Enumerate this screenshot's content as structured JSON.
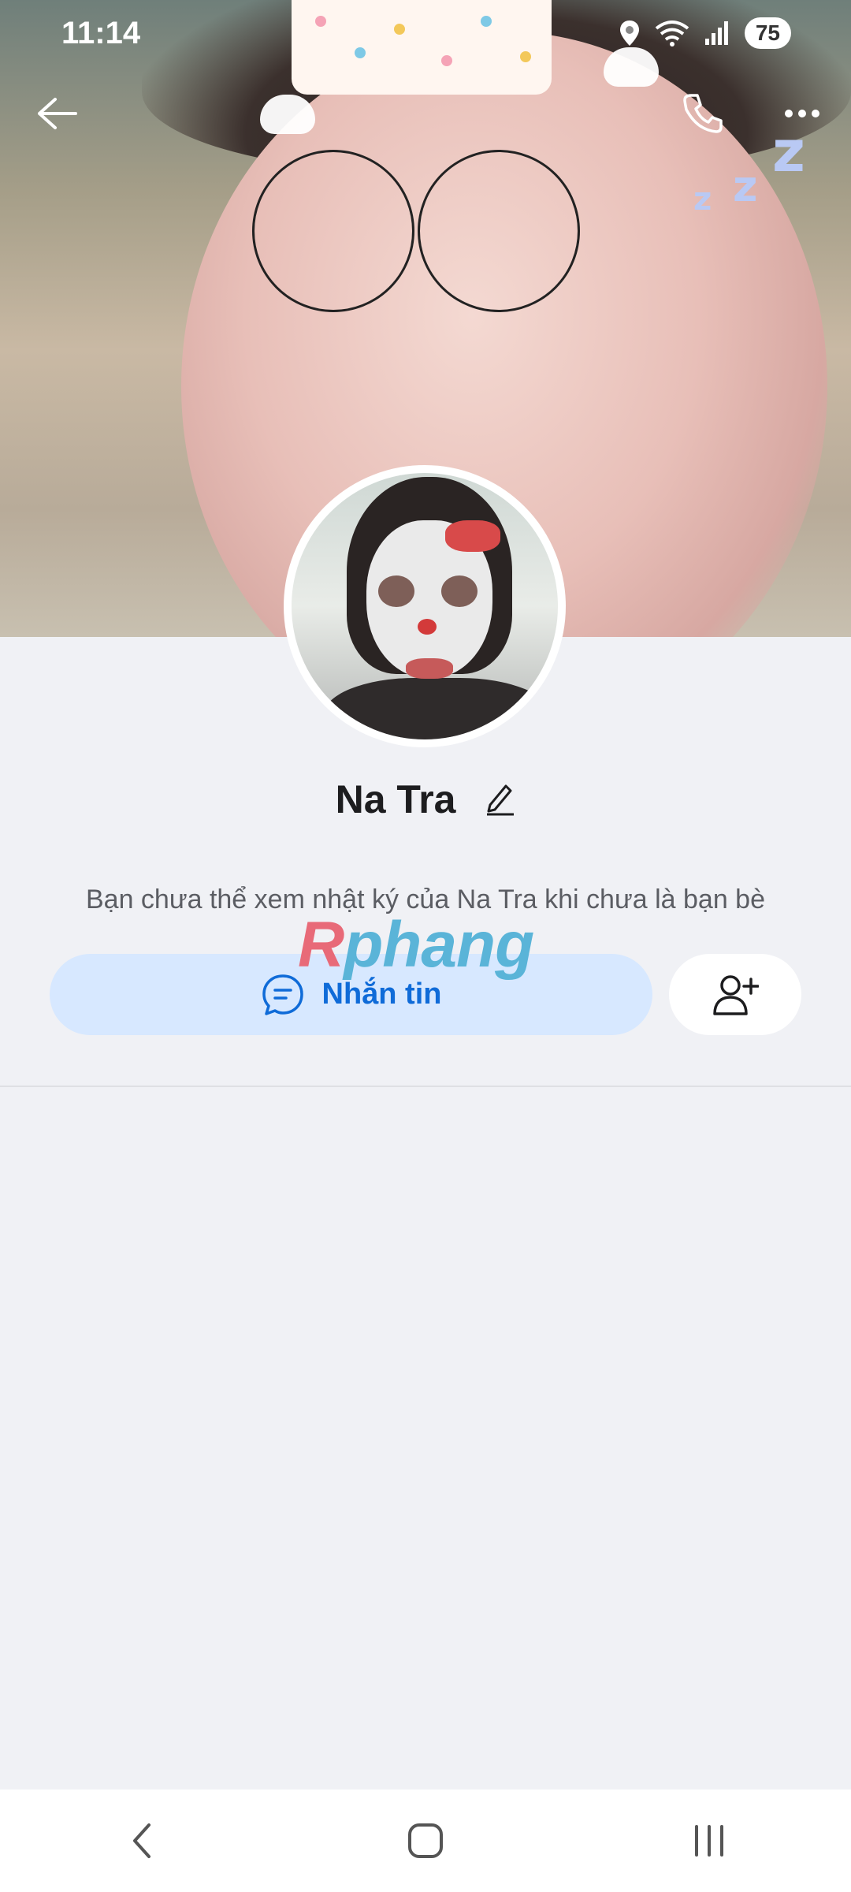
{
  "status_bar": {
    "time": "11:14",
    "battery": "75"
  },
  "profile": {
    "name": "Na Tra",
    "note": "Bạn chưa thể xem nhật ký của Na Tra khi chưa là bạn bè"
  },
  "watermark": {
    "part1": "R",
    "part2": "phang"
  },
  "actions": {
    "message_label": "Nhắn tin"
  },
  "icons": {
    "back": "back-arrow-icon",
    "call": "phone-icon",
    "more": "more-dots-icon",
    "edit": "pencil-icon",
    "chat": "chat-bubble-icon",
    "add_friend": "add-friend-icon"
  },
  "colors": {
    "accent": "#0f6bd8",
    "button_bg": "#d7e8ff",
    "background": "#f0f1f5"
  }
}
